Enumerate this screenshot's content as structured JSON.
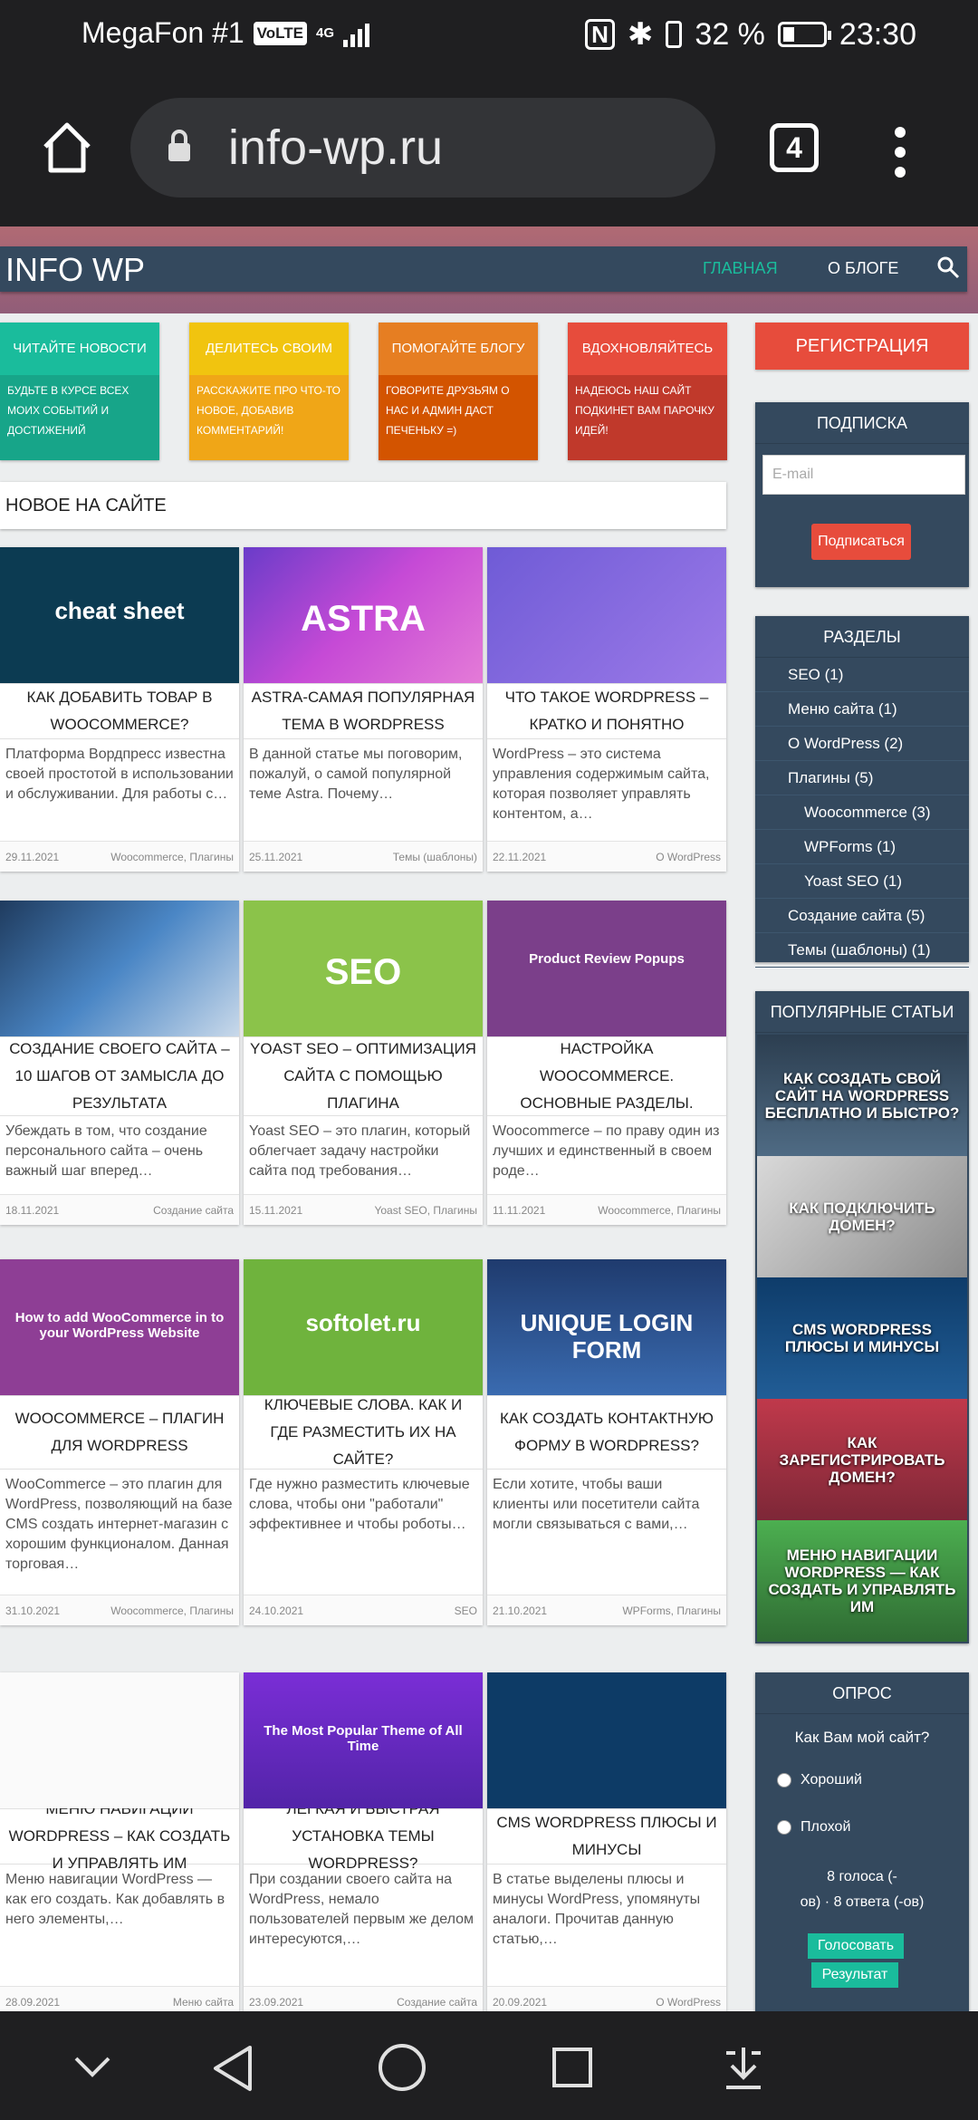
{
  "status_bar": {
    "carrier": "MegaFon #1",
    "volte": "VoLTE",
    "network": "4G",
    "battery": "32 %",
    "time": "23:30"
  },
  "browser": {
    "url": "info-wp.ru",
    "tab_count": "4"
  },
  "site": {
    "logo": "INFO WP",
    "nav": {
      "home": "ГЛАВНАЯ",
      "about": "О БЛОГЕ"
    },
    "features": [
      {
        "title": "Читайте новости",
        "desc": "Будьте в курсе всех моих событий и достижений",
        "color": "#1abc9c"
      },
      {
        "title": "Делитесь своим",
        "desc": "Расскажите про что-то новое, добавив комментарий!",
        "color": "#f1c40f"
      },
      {
        "title": "Помогайте блогу",
        "desc": "Говорите друзьям о нас и админ даст печеньку =)",
        "color": "#e67e22"
      },
      {
        "title": "Вдохновляйтесь",
        "desc": "Надеюсь наш сайт подкинет вам парочку идей!",
        "color": "#e74c3c"
      }
    ],
    "new_heading": "НОВОЕ НА САЙТЕ",
    "posts": [
      {
        "title": "КАК ДОБАВИТЬ ТОВАР В WOOCOMMERCE?",
        "excerpt": "Платформа Вордпресс известна своей простотой в использовании и обслуживании. Для работы с…",
        "date": "29.11.2021",
        "cats": "Woocommerce, Плагины",
        "img_text": "cheat sheet"
      },
      {
        "title": "ASTRA-САМАЯ ПОПУЛЯРНАЯ ТЕМА В WORDPRESS",
        "excerpt": "В данной статье мы поговорим, пожалуй, о самой популярной теме Astra. Почему…",
        "date": "25.11.2021",
        "cats": "Темы (шаблоны)",
        "img_text": "ASTRA"
      },
      {
        "title": "ЧТО ТАКОЕ WORDPRESS – КРАТКО И ПОНЯТНО",
        "excerpt": "WordPress – это система управления содержимым сайта, которая позволяет управлять контентом, а…",
        "date": "22.11.2021",
        "cats": "О WordPress",
        "img_text": ""
      },
      {
        "title": "СОЗДАНИЕ СВОЕГО САЙТА – 10 ШАГОВ ОТ ЗАМЫСЛА ДО РЕЗУЛЬТАТА",
        "excerpt": "Убеждать в том, что создание персонального сайта – очень важный шаг вперед…",
        "date": "18.11.2021",
        "cats": "Создание сайта",
        "img_text": ""
      },
      {
        "title": "YOAST SEO – ОПТИМИЗАЦИЯ САЙТА С ПОМОЩЬЮ ПЛАГИНА",
        "excerpt": "Yoast SEO – это плагин, который облегчает задачу настройки сайта под требования…",
        "date": "15.11.2021",
        "cats": "Yoast SEO, Плагины",
        "img_text": "SEO"
      },
      {
        "title": "НАСТРОЙКА WOOCOMMERCE. ОСНОВНЫЕ РАЗДЕЛЫ.",
        "excerpt": "Woocommerce – по праву один из лучших и единственный в своем роде…",
        "date": "11.11.2021",
        "cats": "Woocommerce, Плагины",
        "img_text": "Product Review Popups"
      },
      {
        "title": "WOOCOMMERCE – ПЛАГИН ДЛЯ WORDPRESS",
        "excerpt": "WooCommerce – это плагин для WordPress, позволяющий на базе CMS создать интернет-магазин с хорошим функционалом. Данная торговая…",
        "date": "31.10.2021",
        "cats": "Woocommerce, Плагины",
        "img_text": "How to add WooCommerce in to your WordPress Website"
      },
      {
        "title": "КЛЮЧЕВЫЕ СЛОВА. КАК И ГДЕ РАЗМЕСТИТЬ ИХ НА САЙТЕ?",
        "excerpt": "Где нужно разместить ключевые слова, чтобы они \"работали\" эффективнее и чтобы роботы…",
        "date": "24.10.2021",
        "cats": "SEO",
        "img_text": "softolet.ru"
      },
      {
        "title": "КАК СОЗДАТЬ КОНТАКТНУЮ ФОРМУ В WORDPRESS?",
        "excerpt": "Если хотите, чтобы ваши клиенты или посетители сайта могли связываться с вами,…",
        "date": "21.10.2021",
        "cats": "WPForms, Плагины",
        "img_text": "UNIQUE LOGIN FORM"
      },
      {
        "title": "МЕНЮ НАВИГАЦИИ WORDPRESS – КАК СОЗДАТЬ И УПРАВЛЯТЬ ИМ",
        "excerpt": "Меню навигации WordPress — как его создать. Как добавлять в него элементы,…",
        "date": "28.09.2021",
        "cats": "Меню сайта",
        "img_text": ""
      },
      {
        "title": "ЛЕГКАЯ И БЫСТРАЯ УСТАНОВКА ТЕМЫ WORDPRESS?",
        "excerpt": "При создании своего сайта на WordPress, немало пользователей первым же делом интересуются,…",
        "date": "23.09.2021",
        "cats": "Создание сайта",
        "img_text": "The Most Popular Theme of All Time"
      },
      {
        "title": "CMS WORDPRESS ПЛЮСЫ И МИНУСЫ",
        "excerpt": "В статье выделены плюсы и минусы WordPress, упомянуты аналоги. Прочитав данную статью,…",
        "date": "20.09.2021",
        "cats": "О WordPress",
        "img_text": ""
      }
    ],
    "sidebar": {
      "register": "РЕГИСТРАЦИЯ",
      "subscribe": {
        "heading": "ПОДПИСКА",
        "placeholder": "E-mail",
        "button": "Подписаться"
      },
      "sections": {
        "heading": "РАЗДЕЛЫ",
        "items": [
          {
            "label": "SEO (1)",
            "indent": 0
          },
          {
            "label": "Меню сайта (1)",
            "indent": 0
          },
          {
            "label": "О WordPress (2)",
            "indent": 0
          },
          {
            "label": "Плагины (5)",
            "indent": 0
          },
          {
            "label": "Woocommerce (3)",
            "indent": 1
          },
          {
            "label": "WPForms (1)",
            "indent": 1
          },
          {
            "label": "Yoast SEO (1)",
            "indent": 1
          },
          {
            "label": "Создание сайта (5)",
            "indent": 0
          },
          {
            "label": "Темы (шаблоны) (1)",
            "indent": 0
          }
        ]
      },
      "popular": {
        "heading": "ПОПУЛЯРНЫЕ СТАТЬИ",
        "items": [
          "КАК СОЗДАТЬ СВОЙ САЙТ НА WORDPRESS БЕСПЛАТНО И БЫСТРО?",
          "КАК ПОДКЛЮЧИТЬ ДОМЕН?",
          "CMS WORDPRESS ПЛЮСЫ И МИНУСЫ",
          "КАК ЗАРЕГИСТРИРОВАТЬ ДОМЕН?",
          "МЕНЮ НАВИГАЦИИ WORDPRESS — КАК СОЗДАТЬ И УПРАВЛЯТЬ ИМ"
        ]
      },
      "poll": {
        "heading": "ОПРОС",
        "question": "Как Вам мой сайт?",
        "options": [
          "Хороший",
          "Плохой"
        ],
        "result_line1": "8 голоса (-",
        "result_line2": "ов) · 8 ответа (-ов)",
        "vote": "Голосовать",
        "results": "Результат"
      }
    }
  }
}
